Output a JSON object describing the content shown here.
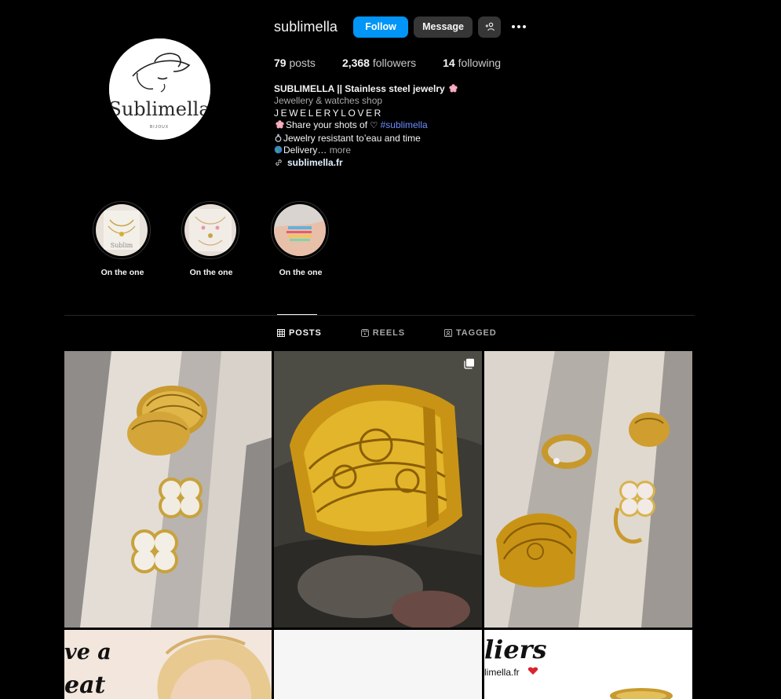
{
  "profile": {
    "username": "sublimella",
    "follow_label": "Follow",
    "message_label": "Message",
    "avatar_text": "Sublimella",
    "avatar_subtext": "BIJOUX"
  },
  "stats": {
    "posts_count": "79",
    "posts_label": "posts",
    "followers_count": "2,368",
    "followers_label": "followers",
    "following_count": "14",
    "following_label": "following"
  },
  "bio": {
    "name": "SUBLIMELLA || Stainless steel jewelry",
    "category": "Jewellery & watches shop",
    "line1": "JEWELERYLOVER",
    "line2_text": "Share your shots of",
    "line2_hashtag": "#sublimella",
    "line3": "Jewelry resistant to’eau and time",
    "line4": "Delivery…",
    "more_label": "more",
    "link": "sublimella.fr"
  },
  "highlights": [
    {
      "label": "On the one"
    },
    {
      "label": "On the one"
    },
    {
      "label": "On the one"
    }
  ],
  "tabs": [
    {
      "label": "POSTS",
      "active": true
    },
    {
      "label": "REELS",
      "active": false
    },
    {
      "label": "TAGGED",
      "active": false
    }
  ],
  "posts_row2": {
    "text_a_line1": "ve a",
    "text_a_line2": "eat",
    "text_c_line1": "liers",
    "text_c_line2": "limella.fr"
  },
  "colors": {
    "background": "#000000",
    "follow_button": "#0095f6",
    "secondary_button": "#363636",
    "hashtag": "#6b8dff",
    "link": "#e0f1ff"
  }
}
